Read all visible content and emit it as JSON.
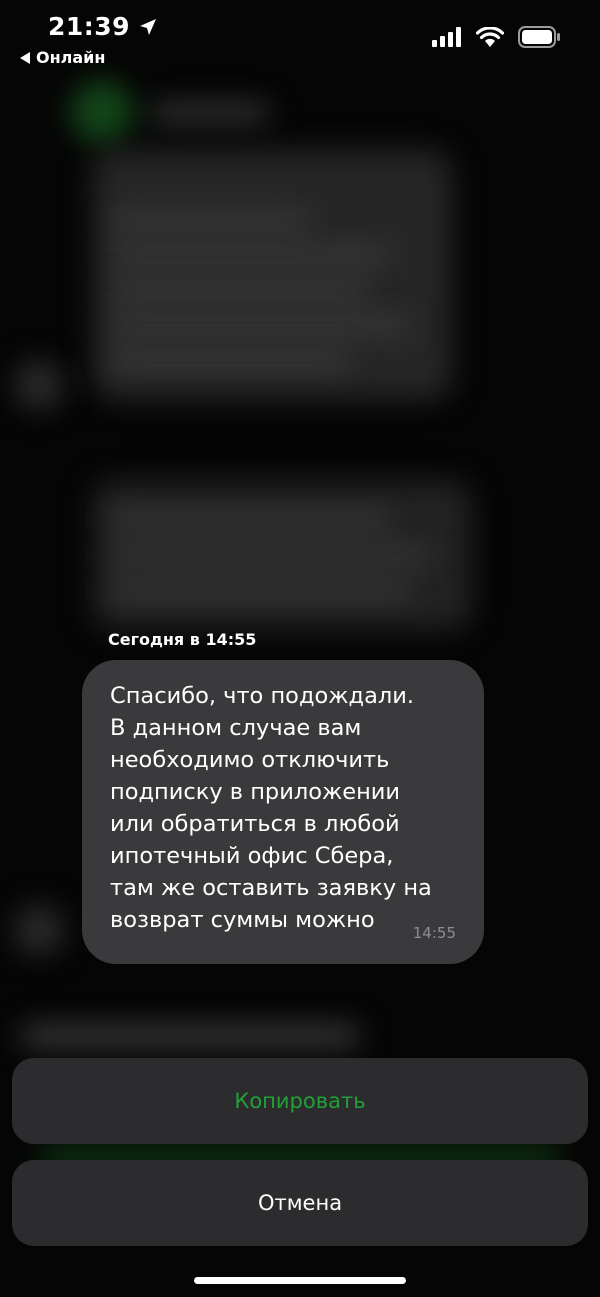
{
  "status_bar": {
    "time": "21:39",
    "back_label": "Онлайн"
  },
  "message": {
    "date_label": "Сегодня в 14:55",
    "text": "Спасибо, что подождали.\nВ данном случае вам\nнеобходимо отключить\nподписку в приложении\nили обратиться в любой\nипотечный офис Сбера,\nтам же оставить заявку на\nвозврат суммы можно",
    "time": "14:55"
  },
  "actions": {
    "copy_label": "Копировать",
    "cancel_label": "Отмена"
  },
  "colors": {
    "accent_green": "#21a038",
    "bubble": "#3a3a3c",
    "sheet": "#2c2c2e"
  },
  "icons": [
    "location-arrow-icon",
    "back-triangle-icon",
    "cellular-signal-icon",
    "wifi-icon",
    "battery-icon"
  ]
}
